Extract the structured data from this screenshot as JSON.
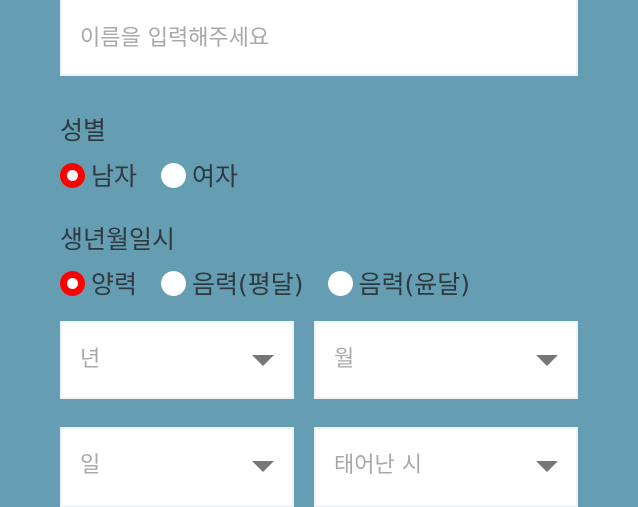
{
  "name": {
    "placeholder": "이름을 입력해주세요"
  },
  "gender": {
    "label": "성별",
    "options": [
      {
        "label": "남자",
        "checked": true
      },
      {
        "label": "여자",
        "checked": false
      }
    ]
  },
  "birth": {
    "label": "생년월일시",
    "calendar_options": [
      {
        "label": "양력",
        "checked": true
      },
      {
        "label": "음력(평달)",
        "checked": false
      },
      {
        "label": "음력(윤달)",
        "checked": false
      }
    ],
    "year_placeholder": "년",
    "month_placeholder": "월",
    "day_placeholder": "일",
    "hour_placeholder": "태어난 시"
  },
  "colors": {
    "background": "#659eb2",
    "radio_checked": "#ff0000",
    "radio_unchecked": "#ffffff"
  }
}
